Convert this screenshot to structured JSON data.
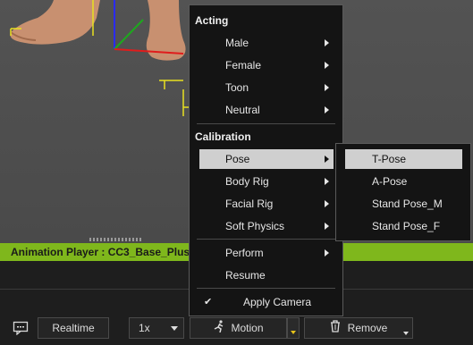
{
  "context_menu": {
    "acting_header": "Acting",
    "acting_items": [
      {
        "label": "Male"
      },
      {
        "label": "Female"
      },
      {
        "label": "Toon"
      },
      {
        "label": "Neutral"
      }
    ],
    "calibration_header": "Calibration",
    "calibration_items": [
      {
        "label": "Pose",
        "highlighted": true
      },
      {
        "label": "Body Rig"
      },
      {
        "label": "Facial Rig"
      },
      {
        "label": "Soft Physics"
      }
    ],
    "other_items": [
      {
        "label": "Perform"
      },
      {
        "label": "Resume"
      }
    ],
    "apply_camera": {
      "label": "Apply Camera",
      "checked": true,
      "check_glyph": "✔"
    }
  },
  "pose_submenu": {
    "items": [
      {
        "label": "T-Pose",
        "highlighted": true
      },
      {
        "label": "A-Pose"
      },
      {
        "label": "Stand Pose_M"
      },
      {
        "label": "Stand Pose_F"
      }
    ]
  },
  "player_bar": {
    "title": "Animation Player : CC3_Base_Plus"
  },
  "toolbar": {
    "realtime_label": "Realtime",
    "speed_value": "1x",
    "motion_label": "Motion",
    "remove_label": "Remove"
  },
  "colors": {
    "accent_green": "#7fb71c",
    "menu_bg": "#141414",
    "highlight": "#cfcfcf"
  }
}
